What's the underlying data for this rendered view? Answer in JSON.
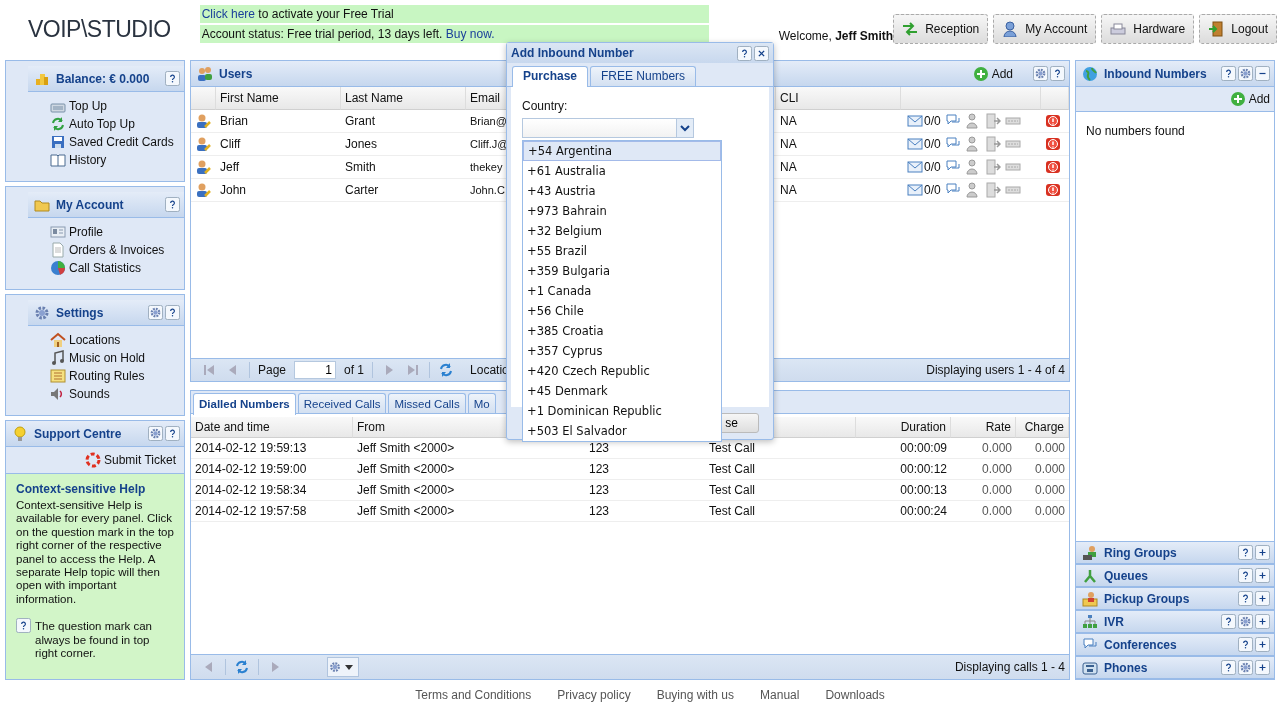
{
  "header": {
    "logo": "VOIP\\STUDIO",
    "notices": [
      {
        "parts": [
          {
            "kind": "link",
            "text": "Click here"
          },
          {
            "kind": "text",
            "text": " to activate your Free Trial"
          }
        ]
      },
      {
        "parts": [
          {
            "kind": "text",
            "text": "Account status: Free trial period, 13 days left. "
          },
          {
            "kind": "link",
            "text": "Buy now."
          }
        ]
      }
    ],
    "welcome": "Welcome, **Jeff Smith**",
    "buttons": [
      "Reception",
      "My Account",
      "Hardware",
      "Logout"
    ]
  },
  "left_panels": [
    {
      "kind": "menu",
      "title": "Balance: € 0.000",
      "items": [
        "Top Up",
        "Auto Top Up",
        "Saved Credit Cards",
        "History"
      ]
    },
    {
      "kind": "menu",
      "title": "My Account",
      "items": [
        "Profile",
        "Orders & Invoices",
        "Call Statistics"
      ]
    },
    {
      "kind": "menu",
      "title": "Settings",
      "items": [
        "Locations",
        "Music on Hold",
        "Routing Rules",
        "Sounds"
      ]
    },
    {
      "kind": "support",
      "title": "Support Centre",
      "action": "Submit Ticket",
      "help_title": "Context-sensitive Help",
      "help_text": "Context-sensitive Help is available for every panel. Click on the question mark in the top right corner of the respective panel to access the Help. A separate Help topic will then open with important information.",
      "help_note": "The question mark can always be found in top right corner."
    }
  ],
  "users_panel": {
    "title": "Users",
    "add": "Add",
    "columns": [
      "First Name",
      "Last Name",
      "Email",
      "CLI"
    ],
    "rows": [
      {
        "first": "Brian",
        "last": "Grant",
        "email": "Brian@",
        "cli": "NA",
        "messages": "0/0"
      },
      {
        "first": "Cliff",
        "last": "Jones",
        "email": "Cliff.J@",
        "cli": "NA",
        "messages": "0/0"
      },
      {
        "first": "Jeff",
        "last": "Smith",
        "email": "thekey",
        "cli": "NA",
        "messages": "0/0"
      },
      {
        "first": "John",
        "last": "Carter",
        "email": "John.C",
        "cli": "NA",
        "messages": "0/0"
      }
    ],
    "pager": {
      "page_label": "Page",
      "page": "1",
      "of": "of 1",
      "column_5": "Locatio",
      "status": "Displaying users 1 - 4 of 4"
    }
  },
  "calls_panel": {
    "tabs": [
      {
        "label": "Dialled Numbers",
        "selected": true
      },
      {
        "label": "Received Calls",
        "selected": false
      },
      {
        "label": "Missed Calls",
        "selected": false
      },
      {
        "label": "Mo",
        "selected": false
      }
    ],
    "columns": [
      "Date and time",
      "From",
      null,
      null,
      "Duration",
      "Rate",
      "Charge"
    ],
    "rows": [
      [
        "2014-02-12 19:59:13",
        "Jeff Smith <2000>",
        "123",
        "Test Call",
        "00:00:09",
        "0.000",
        "0.000"
      ],
      [
        "2014-02-12 19:59:00",
        "Jeff Smith <2000>",
        "123",
        "Test Call",
        "00:00:12",
        "0.000",
        "0.000"
      ],
      [
        "2014-02-12 19:58:34",
        "Jeff Smith <2000>",
        "123",
        "Test Call",
        "00:00:13",
        "0.000",
        "0.000"
      ],
      [
        "2014-02-12 19:57:58",
        "Jeff Smith <2000>",
        "123",
        "Test Call",
        "00:00:24",
        "0.000",
        "0.000"
      ]
    ],
    "status": "Displaying calls 1 - 4"
  },
  "right_panel": {
    "title": "Inbound Numbers",
    "add": "Add",
    "empty": "No numbers found",
    "sections": [
      "Ring Groups",
      "Queues",
      "Pickup Groups",
      "IVR",
      "Conferences",
      "Phones"
    ]
  },
  "footer_links": [
    "Terms and Conditions",
    "Privacy policy",
    "Buying with us",
    "Manual",
    "Downloads"
  ],
  "dialog": {
    "title": "Add Inbound Number",
    "tabs": [
      {
        "label": "Purchase",
        "selected": true
      },
      {
        "label": "FREE Numbers",
        "selected": false
      }
    ],
    "field_label": "Country:",
    "button": "se",
    "options": [
      {
        "label": "+54 Argentina",
        "selected": true
      },
      {
        "label": "+61 Australia",
        "selected": false
      },
      {
        "label": "+43 Austria",
        "selected": false
      },
      {
        "label": "+973 Bahrain",
        "selected": false
      },
      {
        "label": "+32 Belgium",
        "selected": false
      },
      {
        "label": "+55 Brazil",
        "selected": false
      },
      {
        "label": "+359 Bulgaria",
        "selected": false
      },
      {
        "label": "+1 Canada",
        "selected": false
      },
      {
        "label": "+56 Chile",
        "selected": false
      },
      {
        "label": "+385 Croatia",
        "selected": false
      },
      {
        "label": "+357 Cyprus",
        "selected": false
      },
      {
        "label": "+420 Czech Republic",
        "selected": false
      },
      {
        "label": "+45 Denmark",
        "selected": false
      },
      {
        "label": "+1 Dominican Republic",
        "selected": false
      },
      {
        "label": "+503 El Salvador",
        "selected": false
      }
    ]
  }
}
